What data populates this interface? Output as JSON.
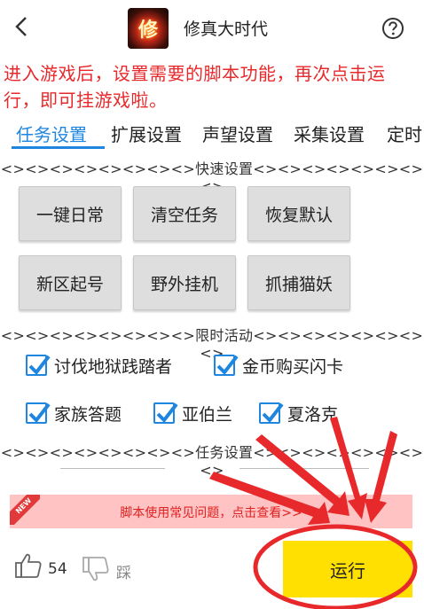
{
  "header": {
    "title": "修真大时代",
    "logo_text": "修"
  },
  "notice": "进入游戏后，设置需要的脚本功能，再次点击运行，即可挂游戏啦。",
  "tabs": [
    {
      "label": "任务设置",
      "active": true
    },
    {
      "label": "扩展设置",
      "active": false
    },
    {
      "label": "声望设置",
      "active": false
    },
    {
      "label": "采集设置",
      "active": false
    },
    {
      "label": "定时",
      "active": false
    }
  ],
  "quick_settings": {
    "divider": "<><><><><><><><>快速设置<><><><><><><><>",
    "buttons": [
      "一键日常",
      "清空任务",
      "恢复默认",
      "新区起号",
      "野外挂机",
      "抓捕猫妖"
    ]
  },
  "limited_events": {
    "divider": "<><><><><><><><>限时活动<><><><><><><><>",
    "options": [
      {
        "label": "讨伐地狱践踏者",
        "checked": true
      },
      {
        "label": "金币购买闪卡",
        "checked": true
      },
      {
        "label": "家族答题",
        "checked": true
      },
      {
        "label": "亚伯兰",
        "checked": true
      },
      {
        "label": "夏洛克",
        "checked": true
      }
    ]
  },
  "task_settings": {
    "divider": "<><><><><><><><>任务设置<><><><><><><><>"
  },
  "faq": {
    "badge": "NEW",
    "text": "脚本使用常见问题，点击查看>>"
  },
  "footer": {
    "like_count": "54",
    "dislike_label": "踩",
    "run_label": "运行"
  },
  "colors": {
    "accent": "#1f86e0",
    "notice": "#e8292b",
    "run_button": "#ffe000",
    "annotation": "#e8292b"
  },
  "icons": [
    "back-arrow-icon",
    "help-icon",
    "thumbs-up-icon",
    "thumbs-down-icon",
    "checkmark-icon"
  ]
}
